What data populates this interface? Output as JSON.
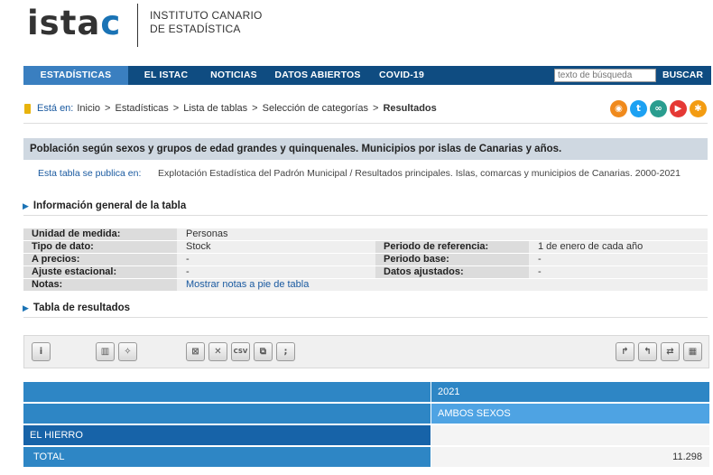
{
  "header": {
    "logo_main": "ista",
    "logo_accent": "c",
    "institute_line1": "INSTITUTO CANARIO",
    "institute_line2": "DE ESTADÍSTICA"
  },
  "nav": {
    "items": [
      "ESTADÍSTICAS",
      "EL ISTAC",
      "NOTICIAS",
      "DATOS ABIERTOS",
      "COVID-19"
    ],
    "active_index": 0,
    "search_placeholder": "texto de búsqueda",
    "search_button": "BUSCAR"
  },
  "breadcrumb": {
    "label": "Está en:",
    "items": [
      "Inicio",
      "Estadísticas",
      "Lista de tablas",
      "Selección de categorías"
    ],
    "current": "Resultados"
  },
  "social": [
    {
      "name": "rss-icon",
      "glyph": "◉",
      "color": "#f08a1c"
    },
    {
      "name": "twitter-icon",
      "glyph": "t",
      "color": "#1da1f2"
    },
    {
      "name": "link-icon",
      "glyph": "∞",
      "color": "#2a9d8f"
    },
    {
      "name": "youtube-icon",
      "glyph": "▶",
      "color": "#e53935"
    },
    {
      "name": "share-icon",
      "glyph": "✱",
      "color": "#f39c12"
    }
  ],
  "table_title": "Población según sexos y grupos de edad grandes y quinquenales. Municipios por islas de Canarias y años.",
  "publication": {
    "label": "Esta tabla se publica en:",
    "value": "Explotación Estadística del Padrón Municipal / Resultados principales. Islas, comarcas y municipios de Canarias. 2000-2021"
  },
  "sections": {
    "general_info": "Información general de la tabla",
    "results": "Tabla de resultados"
  },
  "info": {
    "unidad_label": "Unidad de medida:",
    "unidad_value": "Personas",
    "tipo_label": "Tipo de dato:",
    "tipo_value": "Stock",
    "periodo_ref_label": "Periodo de referencia:",
    "periodo_ref_value": "1 de enero de cada año",
    "precios_label": "A precios:",
    "precios_value": "-",
    "periodo_base_label": "Periodo base:",
    "periodo_base_value": "-",
    "ajuste_label": "Ajuste estacional:",
    "ajuste_value": "-",
    "datos_aj_label": "Datos ajustados:",
    "datos_aj_value": "-",
    "notas_label": "Notas:",
    "notas_link": "Mostrar notas a pie de tabla"
  },
  "toolbar": {
    "info": "i",
    "csv": "CSV",
    "sc": ";"
  },
  "results": {
    "year": "2021",
    "sex": "AMBOS SEXOS",
    "region": "EL HIERRO",
    "row_label": "TOTAL",
    "row_value": "11.298"
  }
}
